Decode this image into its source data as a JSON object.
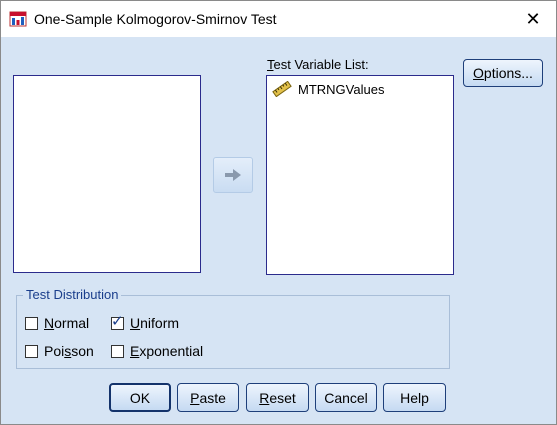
{
  "window": {
    "title": "One-Sample Kolmogorov-Smirnov Test",
    "close_glyph": "✕"
  },
  "test_variable_list": {
    "label_accel": "T",
    "label_rest": "est Variable List:",
    "items": [
      {
        "label": "MTRNGValues",
        "icon": "scale-ruler-icon"
      }
    ]
  },
  "options_button": {
    "accel": "O",
    "rest": "ptions..."
  },
  "test_distribution": {
    "title": "Test Distribution",
    "normal": {
      "accel": "N",
      "rest": "ormal",
      "checked": false
    },
    "uniform": {
      "accel": "U",
      "rest": "niform",
      "checked": true
    },
    "poisson": {
      "pre": "Poi",
      "accel": "s",
      "rest": "son",
      "checked": false
    },
    "exponential": {
      "accel": "E",
      "rest": "xponential",
      "checked": false
    }
  },
  "buttons": {
    "ok": "OK",
    "paste": {
      "accel": "P",
      "rest": "aste"
    },
    "reset": {
      "accel": "R",
      "rest": "eset"
    },
    "cancel": "Cancel",
    "help": "Help"
  },
  "colors": {
    "dialog_bg": "#d6e4f4",
    "group_title": "#1a3e8c",
    "list_border": "#2b2b8c"
  }
}
